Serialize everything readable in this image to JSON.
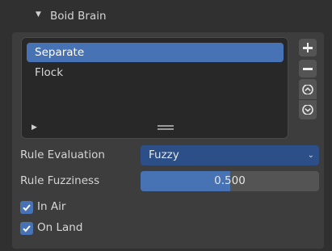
{
  "panel": {
    "title": "Boid Brain",
    "expand_icon": "triangle-down-icon"
  },
  "rules_list": {
    "items": [
      {
        "label": "Separate",
        "selected": true
      },
      {
        "label": "Flock",
        "selected": false
      }
    ],
    "add_icon": "plus-icon",
    "remove_icon": "minus-icon",
    "move_up_icon": "chevron-up-icon",
    "move_down_icon": "chevron-down-icon",
    "expand_icon": "triangle-right-icon",
    "resize_icon": "grip-icon"
  },
  "properties": {
    "rule_evaluation": {
      "label": "Rule Evaluation",
      "value": "Fuzzy"
    },
    "rule_fuzziness": {
      "label": "Rule Fuzziness",
      "value": "0.500",
      "fraction": 0.5
    },
    "in_air": {
      "label": "In Air",
      "checked": true
    },
    "on_land": {
      "label": "On Land",
      "checked": true
    }
  },
  "colors": {
    "accent": "#4772b3",
    "dropdown_bg": "#2b4f86",
    "panel_bg": "#3d3d3d",
    "list_bg": "#282828"
  }
}
